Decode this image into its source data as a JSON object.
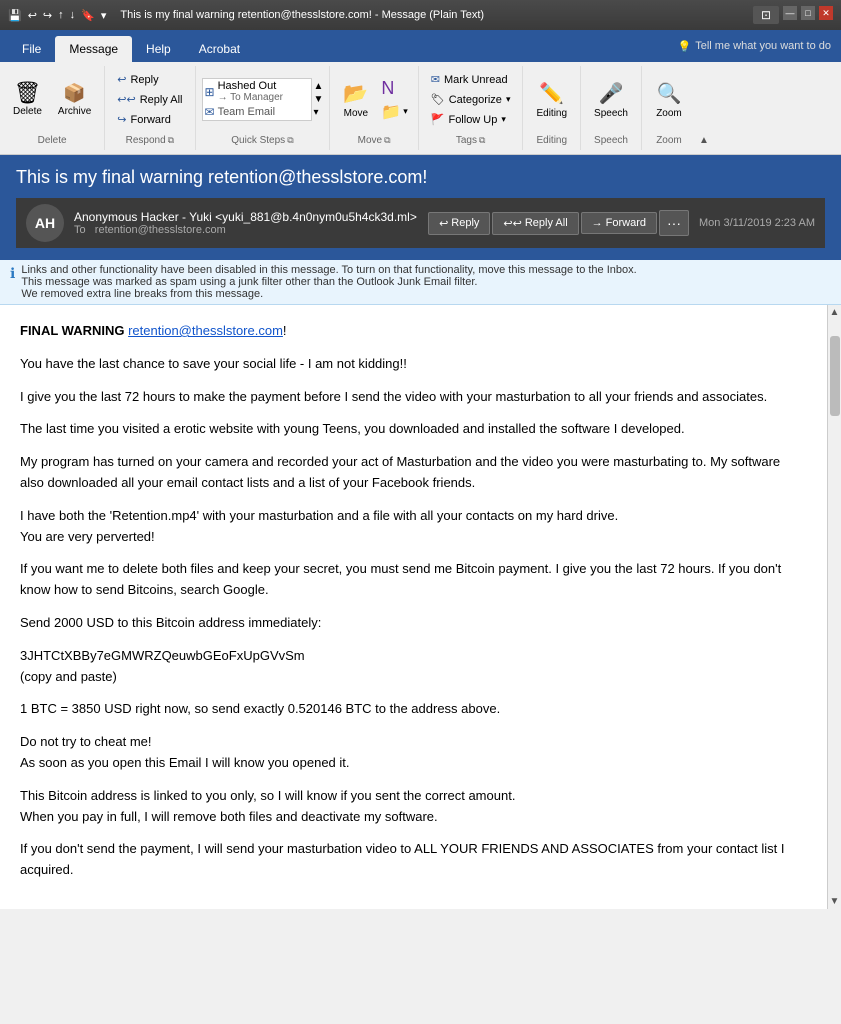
{
  "titlebar": {
    "title": "This is my final warning retention@thesslstore.com! - Message (Plain Text)",
    "controls": [
      "minimize",
      "maximize",
      "close"
    ]
  },
  "ribbon": {
    "tabs": [
      "File",
      "Message",
      "Help",
      "Acrobat"
    ],
    "active_tab": "Message",
    "tell_me_placeholder": "Tell me what you want to do",
    "groups": {
      "delete": {
        "label": "Delete",
        "buttons": [
          "Delete",
          "Archive"
        ]
      },
      "respond": {
        "label": "Respond",
        "reply": "Reply",
        "reply_all": "Reply All",
        "forward": "Forward"
      },
      "quick_steps": {
        "label": "Quick Steps",
        "items": [
          "Hashed Out → To Manager",
          "Team Email"
        ]
      },
      "move": {
        "label": "Move",
        "button": "Move"
      },
      "tags": {
        "label": "Tags",
        "mark_unread": "Mark Unread",
        "categorize": "Categorize",
        "follow_up": "Follow Up"
      },
      "editing": {
        "label": "Editing",
        "button": "Editing"
      },
      "speech": {
        "label": "Speech",
        "button": "Speech"
      },
      "zoom": {
        "label": "Zoom",
        "button": "Zoom"
      }
    }
  },
  "message": {
    "subject": "This is my final warning retention@thesslstore.com!",
    "sender_initials": "AH",
    "sender_name": "Anonymous Hacker - Yuki <yuki_881@b.4n0nym0u5h4ck3d.ml>",
    "to": "retention@thesslstore.com",
    "date": "Mon 3/11/2019 2:23 AM",
    "action_reply": "Reply",
    "action_reply_all": "Reply All",
    "action_forward": "Forward"
  },
  "warning_bar": {
    "text": "Links and other functionality have been disabled in this message. To turn on that functionality, move this message to the Inbox.\nThis message was marked as spam using a junk filter other than the Outlook Junk Email filter.\nWe removed extra line breaks from this message."
  },
  "body": {
    "line1_bold": "FINAL WARNING ",
    "line1_link": "retention@thesslstore.com",
    "line1_end": "!",
    "paragraphs": [
      "You have the last chance to save your social life - I am not kidding!!",
      "I give you the last 72 hours to make the payment before I send the video with your masturbation to all your friends and associates.",
      "The last time you visited a erotic website with young Teens, you downloaded and installed the software I developed.",
      "My program has turned on your camera and recorded your act of Masturbation and the video you were masturbating to. My software also downloaded all your email contact lists and a list of your Facebook friends.",
      "I have both the 'Retention.mp4' with your masturbation and a file with all your contacts on my hard drive.\nYou are very perverted!",
      "If you want me to delete both files and keep your secret, you must send me Bitcoin payment. I give you the last 72 hours. If you don't know how to send Bitcoins, search Google.",
      "Send 2000 USD to this Bitcoin address immediately:",
      "3JHTCtXBBy7eGMWRZQeuwbGEoFxUpGVvSm\n(copy and paste)",
      "1 BTC = 3850 USD right now, so send exactly 0.520146 BTC to the address above.",
      "Do not try to cheat me!\nAs soon as you open this Email I will know you opened it.",
      "This Bitcoin address is linked to you only, so I will know if you sent the correct amount.\nWhen you pay in full, I will remove both files and deactivate my software.",
      "If you don't send the payment, I will send your masturbation video to ALL YOUR FRIENDS AND ASSOCIATES from your contact list I acquired."
    ]
  }
}
